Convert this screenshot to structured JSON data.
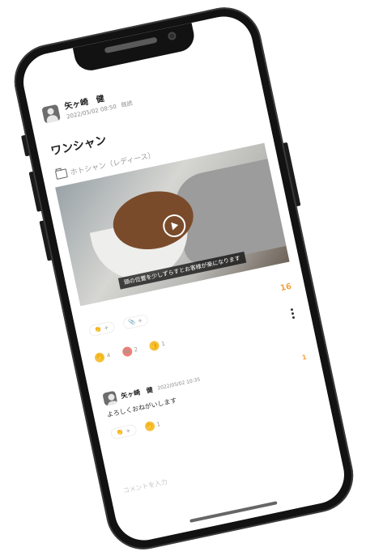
{
  "post": {
    "author": "矢ヶ崎　健",
    "datetime": "2022/05/02 08:50",
    "status": "既読",
    "title": "ワンシャン",
    "category": "ホトシャン（レディース）",
    "video_caption": "頭の位置を少しずらすとお客様が楽になります"
  },
  "actions": {
    "clap_count": "+",
    "attach_count": "+",
    "total_count": "16"
  },
  "reactions": [
    {
      "icon": "clap-emoji",
      "color": "#f6c13a",
      "count": "4"
    },
    {
      "icon": "smile-emoji",
      "color": "#f17f74",
      "count": "2"
    },
    {
      "icon": "thumbs-up-emoji",
      "color": "#f6c13a",
      "count": "1"
    }
  ],
  "comment": {
    "author": "矢ヶ崎　健",
    "datetime": "2022/05/02 10:35",
    "text": "よろしくおねがいします",
    "clap_count": "+",
    "reaction_count": "1",
    "side_count": "1"
  },
  "input": {
    "placeholder": "コメントを入力"
  }
}
